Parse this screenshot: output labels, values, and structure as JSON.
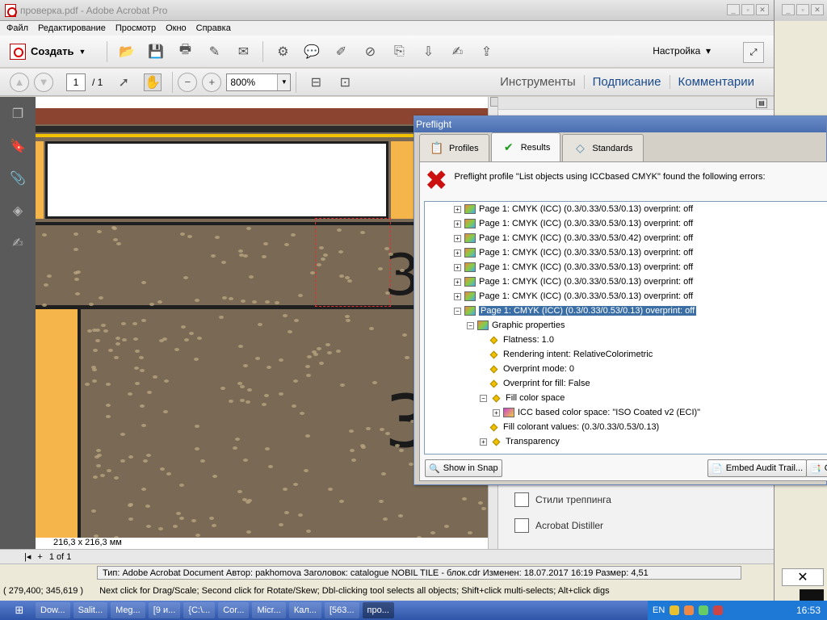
{
  "window": {
    "title": "проверка.pdf - Adobe Acrobat Pro"
  },
  "menu": [
    "Файл",
    "Редактирование",
    "Просмотр",
    "Окно",
    "Справка"
  ],
  "toolbar": {
    "create_label": "Создать",
    "setup_label": "Настройка",
    "icons": [
      "open-folder-icon",
      "save-icon",
      "print-icon",
      "edit-icon",
      "email-icon",
      "gear-icon",
      "comment-icon",
      "highlight-icon",
      "link-icon",
      "attach-icon",
      "stamp-icon",
      "sign-icon",
      "upload-icon"
    ]
  },
  "nav": {
    "page_current": "1",
    "page_total": "/  1",
    "zoom": "800%",
    "tabs": [
      "Инструменты",
      "Подписание",
      "Комментарии"
    ]
  },
  "doc": {
    "dimensions": "216,3 x 216,3 мм"
  },
  "right_panel": {
    "items": [
      "Стили треппинга",
      "Acrobat Distiller"
    ]
  },
  "preflight": {
    "title": "Preflight",
    "tabs": [
      "Profiles",
      "Results",
      "Standards"
    ],
    "error_text": "Preflight profile \"List objects using ICCbased CMYK\" found the following errors:",
    "rows": [
      {
        "text": "Page 1: CMYK (ICC) (0.3/0.33/0.53/0.13)  overprint: off"
      },
      {
        "text": "Page 1: CMYK (ICC) (0.3/0.33/0.53/0.13)  overprint: off"
      },
      {
        "text": "Page 1: CMYK (ICC) (0.3/0.33/0.53/0.42)  overprint: off"
      },
      {
        "text": "Page 1: CMYK (ICC) (0.3/0.33/0.53/0.13)  overprint: off"
      },
      {
        "text": "Page 1: CMYK (ICC) (0.3/0.33/0.53/0.13)  overprint: off"
      },
      {
        "text": "Page 1: CMYK (ICC) (0.3/0.33/0.53/0.13)  overprint: off"
      },
      {
        "text": "Page 1: CMYK (ICC) (0.3/0.33/0.53/0.13)  overprint: off"
      },
      {
        "text": "Page 1: CMYK (ICC) (0.3/0.33/0.53/0.13)  overprint: off"
      }
    ],
    "props_header": "Graphic properties",
    "props": [
      "Flatness: 1.0",
      "Rendering intent: RelativeColorimetric",
      "Overprint mode: 0",
      "Overprint for fill: False",
      "Fill color space"
    ],
    "icc_label": "ICC based color space: \"ISO Coated v2 (ECI)\"",
    "fill_colorant": "Fill colorant values: (0.3/0.33/0.53/0.13)",
    "transparency": "Transparency",
    "btn_snap": "Show in Snap",
    "btn_audit": "Embed Audit Trail...",
    "btn_cr": "Cr"
  },
  "bottom": {
    "page_label": "1 of 1",
    "info": "Тип: Adobe Acrobat Document Автор: pakhomova Заголовок: catalogue NOBIL TILE - блок.cdr Изменен: 18.07.2017 16:19 Размер: 4,51",
    "coords": "( 279,400; 345,619 )",
    "hint": "Next click for Drag/Scale; Second click for Rotate/Skew; Dbl-clicking tool selects all objects; Shift+click multi-selects; Alt+click digs"
  },
  "taskbar": {
    "items": [
      "Dow...",
      "Salit...",
      "Meg...",
      "[9 и...",
      "{C:\\...",
      "Cor...",
      "Micr...",
      "Кал...",
      "[563...",
      "про..."
    ],
    "lang": "EN",
    "time": "16:53"
  },
  "colors": {
    "error_red": "#cc1010",
    "selection_blue": "#3a6ea5",
    "titlebar_blue": "#4a6eb0"
  }
}
